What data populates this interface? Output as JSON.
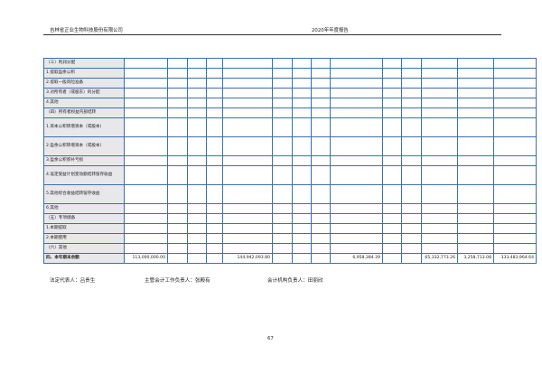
{
  "header": {
    "company": "吉林省正业生物科技股份有限公司",
    "report": "2020年年度报告"
  },
  "rows": [
    {
      "label": "（三）利润分配"
    },
    {
      "label": "1.提取盈余公积"
    },
    {
      "label": "2.提取一般风险准备"
    },
    {
      "label": "3.对所有者（或股东）的分配"
    },
    {
      "label": "4.其他"
    },
    {
      "label": "（四）所有者权益内部结转"
    },
    {
      "label": "1.资本公积转增资本（或股本）"
    },
    {
      "label": "2.盈余公积转增资本（或股本）"
    },
    {
      "label": "3.盈余公积弥补亏损"
    },
    {
      "label": "4.设定受益计划变动额结转留存收益"
    },
    {
      "label": "5.其他综合收益结转留存收益"
    },
    {
      "label": "6.其他"
    },
    {
      "label": "（五）专项储备"
    },
    {
      "label": "1.本期提取"
    },
    {
      "label": "2.本期使用"
    },
    {
      "label": "（六）其他"
    }
  ],
  "total_row": {
    "label": "四、本年期末余额",
    "values": [
      "113,000,000.00",
      "",
      "",
      "",
      "144,942,093.80",
      "",
      "",
      "",
      "6,958,384.39",
      "",
      "",
      "65,332,773.26",
      "3,258,713.08",
      "333,483,964.64"
    ]
  },
  "signatures": {
    "legal_rep": "法定代表人：吕贵生",
    "accounting_head": "主管会计工作负责人：张殿有",
    "accounting_dept_head": "会计机构负责人：田丽欣"
  },
  "page_number": "67"
}
